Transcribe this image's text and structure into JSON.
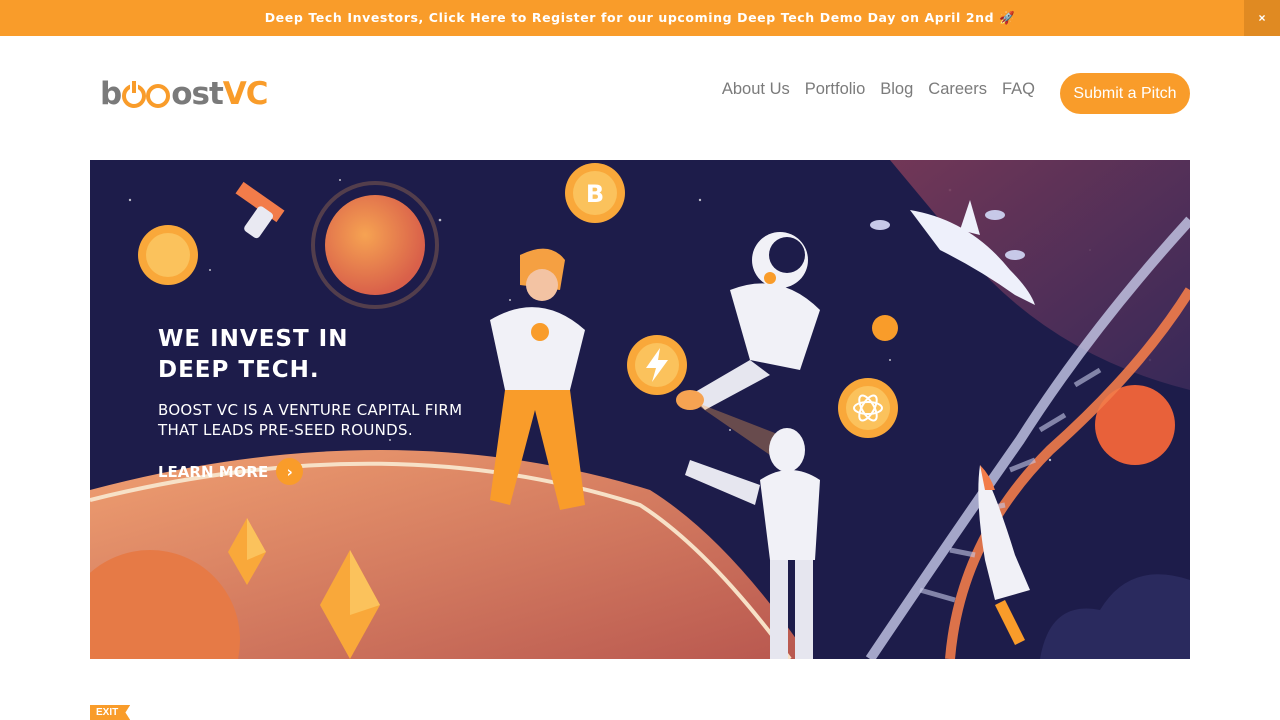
{
  "announcement": {
    "text": "Deep Tech Investors, Click Here to Register for our upcoming Deep Tech Demo Day on April 2nd 🚀",
    "close_label": "×"
  },
  "logo": {
    "part1": "b",
    "part2": "ost",
    "part3": "VC"
  },
  "nav": {
    "items": [
      {
        "label": "About Us"
      },
      {
        "label": "Portfolio"
      },
      {
        "label": "Blog"
      },
      {
        "label": "Careers"
      },
      {
        "label": "FAQ"
      }
    ],
    "cta_label": "Submit a Pitch"
  },
  "hero": {
    "headline_line1": "WE INVEST IN",
    "headline_line2": "DEEP TECH.",
    "sub_line1": "BOOST VC IS A VENTURE CAPITAL FIRM",
    "sub_line2": "THAT LEADS PRE-SEED ROUNDS.",
    "cta_label": "LEARN MORE",
    "cta_arrow": "›",
    "coin_bitcoin": "B"
  },
  "exit_badge": "EXIT",
  "colors": {
    "brand_orange": "#f99c2a",
    "hero_bg": "#1d1c4a",
    "nav_text": "#7b7b7b"
  },
  "icons": [
    "close-icon",
    "rocket-emoji",
    "chevron-right-icon",
    "bitcoin-icon",
    "astronaut",
    "robot",
    "dna-helix",
    "shark",
    "rocket",
    "ethereum-icon",
    "atom-icon",
    "lightning-icon",
    "headphones-icon",
    "satellite"
  ]
}
